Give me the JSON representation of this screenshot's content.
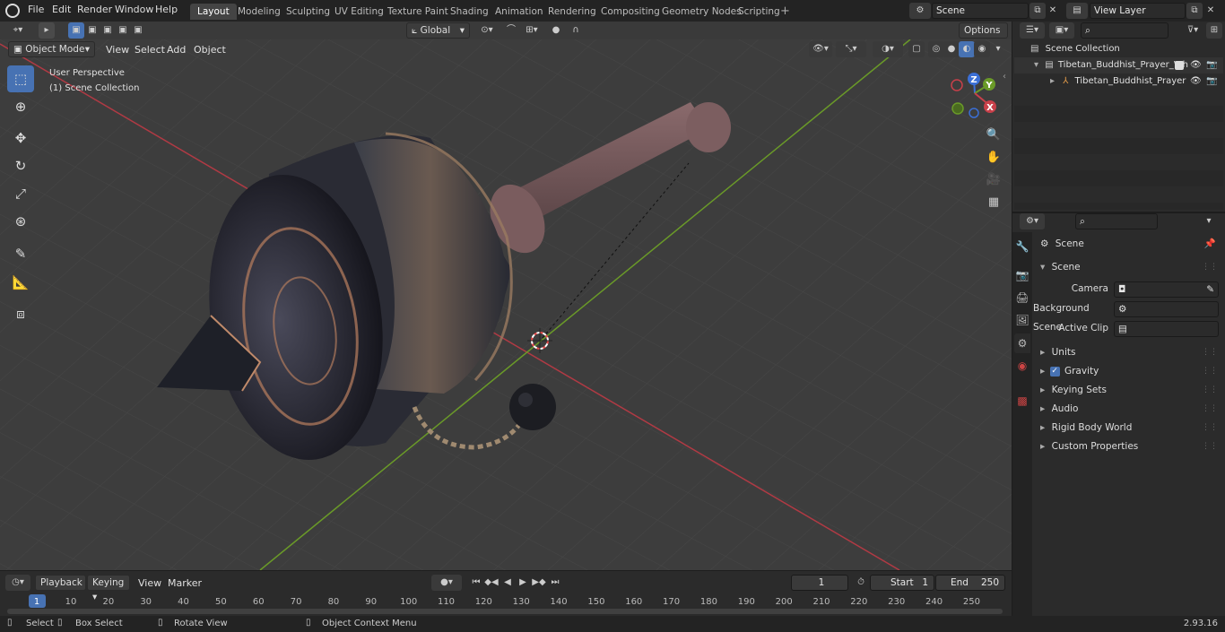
{
  "menubar": {
    "items": [
      "File",
      "Edit",
      "Render",
      "Window",
      "Help"
    ]
  },
  "workspaces": [
    {
      "label": "Layout",
      "active": true
    },
    {
      "label": "Modeling",
      "active": false
    },
    {
      "label": "Sculpting",
      "active": false
    },
    {
      "label": "UV Editing",
      "active": false
    },
    {
      "label": "Texture Paint",
      "active": false
    },
    {
      "label": "Shading",
      "active": false
    },
    {
      "label": "Animation",
      "active": false
    },
    {
      "label": "Rendering",
      "active": false
    },
    {
      "label": "Compositing",
      "active": false
    },
    {
      "label": "Geometry Nodes",
      "active": false
    },
    {
      "label": "Scripting",
      "active": false
    }
  ],
  "add_workspace": "+",
  "scene_field": "Scene",
  "view_layer_field": "View Layer",
  "viewport_header": {
    "transform_orientation": "Global",
    "options": "Options",
    "mode": "Object Mode",
    "menus": [
      "View",
      "Select",
      "Add",
      "Object"
    ]
  },
  "viewport": {
    "perspective_label": "User Perspective",
    "collection_label": "(1) Scene Collection",
    "gizmo_axes": {
      "z": "Z",
      "y": "Y",
      "x": "X"
    }
  },
  "timeline": {
    "menus": [
      "Playback",
      "Keying",
      "View",
      "Marker"
    ],
    "current_frame": "1",
    "start_label": "Start",
    "start_value": "1",
    "end_label": "End",
    "end_value": "250",
    "ticks": [
      "1",
      "10",
      "20",
      "30",
      "40",
      "50",
      "60",
      "70",
      "80",
      "90",
      "100",
      "110",
      "120",
      "130",
      "140",
      "150",
      "160",
      "170",
      "180",
      "190",
      "200",
      "210",
      "220",
      "230",
      "240",
      "250"
    ]
  },
  "statusbar": {
    "select": "Select",
    "box_select": "Box Select",
    "rotate_view": "Rotate View",
    "context_menu": "Object Context Menu",
    "version": "2.93.16"
  },
  "outliner": {
    "root": "Scene Collection",
    "collection": "Tibetan_Buddhist_Prayer_Wh",
    "object": "Tibetan_Buddhist_Prayer"
  },
  "properties": {
    "context": "Scene",
    "panel": "Scene",
    "fields": [
      {
        "label": "Camera",
        "value": ""
      },
      {
        "label": "Background Scene",
        "value": ""
      },
      {
        "label": "Active Clip",
        "value": ""
      }
    ],
    "sections": [
      {
        "label": "Units",
        "checkbox": false
      },
      {
        "label": "Gravity",
        "checkbox": true
      },
      {
        "label": "Keying Sets",
        "checkbox": false
      },
      {
        "label": "Audio",
        "checkbox": false
      },
      {
        "label": "Rigid Body World",
        "checkbox": false
      },
      {
        "label": "Custom Properties",
        "checkbox": false
      }
    ]
  },
  "colors": {
    "accent": "#4772b3",
    "x_axis": "#c8404a",
    "y_axis": "#6a9a28"
  }
}
